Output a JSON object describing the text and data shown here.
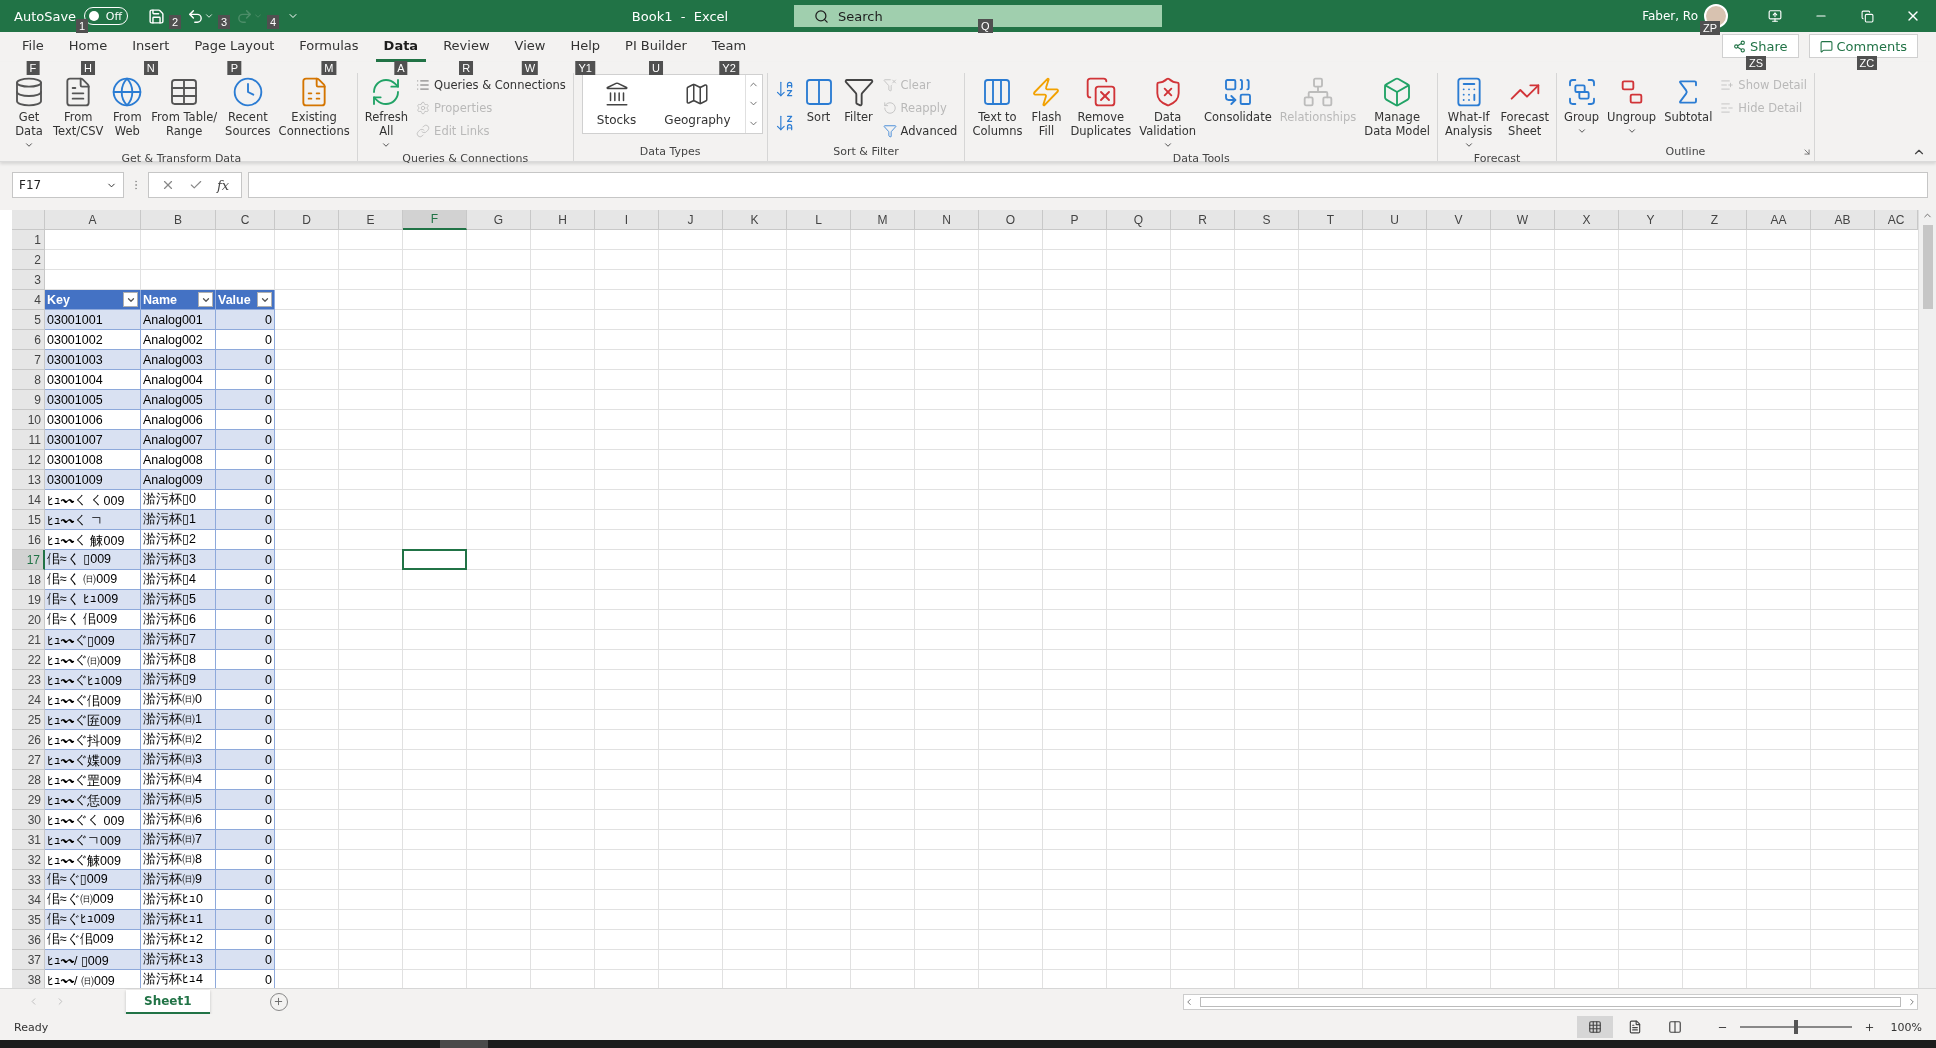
{
  "title_bar": {
    "autosave": {
      "label": "AutoSave",
      "state_text": "Off",
      "on": false,
      "key_tip": "1"
    },
    "quick_access": [
      {
        "kind": "save",
        "key_tip": "2",
        "disabled": false
      },
      {
        "kind": "undo",
        "key_tip": "3",
        "disabled": false
      },
      {
        "kind": "redo",
        "key_tip": "4",
        "disabled": true
      }
    ],
    "title": "Book1  -  Excel",
    "search": {
      "placeholder": "Search",
      "key_tip": "Q"
    },
    "user": {
      "name": "Faber, Ro",
      "key_tip": "ZP"
    }
  },
  "ribbon": {
    "tabs": [
      {
        "label": "File",
        "key_tip": "F",
        "selected": false
      },
      {
        "label": "Home",
        "key_tip": "H",
        "selected": false
      },
      {
        "label": "Insert",
        "key_tip": "N",
        "selected": false
      },
      {
        "label": "Page Layout",
        "key_tip": "P",
        "selected": false
      },
      {
        "label": "Formulas",
        "key_tip": "M",
        "selected": false
      },
      {
        "label": "Data",
        "key_tip": "A",
        "selected": true
      },
      {
        "label": "Review",
        "key_tip": "R",
        "selected": false
      },
      {
        "label": "View",
        "key_tip": "W",
        "selected": false
      },
      {
        "label": "Help",
        "key_tip": "Y1",
        "selected": false
      },
      {
        "label": "PI Builder",
        "key_tip": "U",
        "selected": false
      },
      {
        "label": "Team",
        "key_tip": "Y2",
        "selected": false
      }
    ],
    "share": {
      "label": "Share",
      "key_tip": "ZS"
    },
    "comments": {
      "label": "Comments",
      "key_tip": "ZC"
    },
    "groups": [
      {
        "label": "Get & Transform Data",
        "items": [
          {
            "kind": "large",
            "label": "Get\nData",
            "dropdown": true,
            "disabled": false
          },
          {
            "kind": "large",
            "label": "From\nText/CSV",
            "dropdown": false,
            "disabled": false
          },
          {
            "kind": "large",
            "label": "From\nWeb",
            "dropdown": false,
            "disabled": false
          },
          {
            "kind": "large",
            "label": "From Table/\nRange",
            "dropdown": false,
            "disabled": false
          },
          {
            "kind": "large",
            "label": "Recent\nSources",
            "dropdown": false,
            "disabled": false
          },
          {
            "kind": "large",
            "label": "Existing\nConnections",
            "dropdown": false,
            "disabled": false
          }
        ]
      },
      {
        "label": "Queries & Connections",
        "items": [
          {
            "kind": "large",
            "label": "Refresh\nAll",
            "dropdown": true,
            "disabled": false
          },
          {
            "kind": "small",
            "label": "Queries & Connections",
            "dropdown": false,
            "disabled": false
          },
          {
            "kind": "small",
            "label": "Properties",
            "dropdown": false,
            "disabled": true
          },
          {
            "kind": "small",
            "label": "Edit Links",
            "dropdown": false,
            "disabled": true
          }
        ]
      },
      {
        "label": "Data Types",
        "items": [
          {
            "kind": "gallery",
            "label": "Stocks",
            "dropdown": false,
            "disabled": false
          },
          {
            "kind": "gallery",
            "label": "Geography",
            "dropdown": false,
            "disabled": false
          }
        ]
      },
      {
        "label": "Sort & Filter",
        "items": [
          {
            "kind": "icon",
            "dropdown": false,
            "disabled": false
          },
          {
            "kind": "icon",
            "dropdown": false,
            "disabled": false
          },
          {
            "kind": "large",
            "label": "Sort",
            "dropdown": false,
            "disabled": false
          },
          {
            "kind": "large",
            "label": "Filter",
            "dropdown": false,
            "disabled": false
          },
          {
            "kind": "small",
            "label": "Clear",
            "dropdown": false,
            "disabled": true
          },
          {
            "kind": "small",
            "label": "Reapply",
            "dropdown": false,
            "disabled": true
          },
          {
            "kind": "small",
            "label": "Advanced",
            "dropdown": false,
            "disabled": false
          }
        ]
      },
      {
        "label": "Data Tools",
        "items": [
          {
            "kind": "large",
            "label": "Text to\nColumns",
            "dropdown": false,
            "disabled": false
          },
          {
            "kind": "large",
            "label": "Flash\nFill",
            "dropdown": false,
            "disabled": false
          },
          {
            "kind": "large",
            "label": "Remove\nDuplicates",
            "dropdown": false,
            "disabled": false
          },
          {
            "kind": "large",
            "label": "Data\nValidation",
            "dropdown": true,
            "disabled": false
          },
          {
            "kind": "large",
            "label": "Consolidate",
            "dropdown": false,
            "disabled": false
          },
          {
            "kind": "large",
            "label": "Relationships",
            "dropdown": false,
            "disabled": true
          },
          {
            "kind": "large",
            "label": "Manage\nData Model",
            "dropdown": false,
            "disabled": false
          }
        ]
      },
      {
        "label": "Forecast",
        "items": [
          {
            "kind": "large",
            "label": "What-If\nAnalysis",
            "dropdown": true,
            "disabled": false
          },
          {
            "kind": "large",
            "label": "Forecast\nSheet",
            "dropdown": false,
            "disabled": false
          }
        ]
      },
      {
        "label": "Outline",
        "items": [
          {
            "kind": "large",
            "label": "Group",
            "dropdown": true,
            "disabled": false
          },
          {
            "kind": "large",
            "label": "Ungroup",
            "dropdown": true,
            "disabled": false
          },
          {
            "kind": "large",
            "label": "Subtotal",
            "dropdown": false,
            "disabled": false
          },
          {
            "kind": "small",
            "label": "Show Detail",
            "dropdown": false,
            "disabled": true
          },
          {
            "kind": "small",
            "label": "Hide Detail",
            "dropdown": false,
            "disabled": true
          }
        ]
      }
    ]
  },
  "formula_bar": {
    "name_box": "F17",
    "fx_label": "fx"
  },
  "sheet": {
    "columns": [
      {
        "label": "A",
        "selected": false
      },
      {
        "label": "B",
        "selected": false
      },
      {
        "label": "C",
        "selected": false
      },
      {
        "label": "D",
        "selected": false
      },
      {
        "label": "E",
        "selected": false
      },
      {
        "label": "F",
        "selected": true
      },
      {
        "label": "G",
        "selected": false
      },
      {
        "label": "H",
        "selected": false
      },
      {
        "label": "I",
        "selected": false
      },
      {
        "label": "J",
        "selected": false
      },
      {
        "label": "K",
        "selected": false
      },
      {
        "label": "L",
        "selected": false
      },
      {
        "label": "M",
        "selected": false
      },
      {
        "label": "N",
        "selected": false
      },
      {
        "label": "O",
        "selected": false
      },
      {
        "label": "P",
        "selected": false
      },
      {
        "label": "Q",
        "selected": false
      },
      {
        "label": "R",
        "selected": false
      },
      {
        "label": "S",
        "selected": false
      },
      {
        "label": "T",
        "selected": false
      },
      {
        "label": "U",
        "selected": false
      },
      {
        "label": "V",
        "selected": false
      },
      {
        "label": "W",
        "selected": false
      },
      {
        "label": "X",
        "selected": false
      },
      {
        "label": "Y",
        "selected": false
      },
      {
        "label": "Z",
        "selected": false
      },
      {
        "label": "AA",
        "selected": false
      },
      {
        "label": "AB",
        "selected": false
      },
      {
        "label": "AC",
        "selected": false
      }
    ],
    "rows": [
      {
        "number": "1",
        "selected": false
      },
      {
        "number": "2",
        "selected": false
      },
      {
        "number": "3",
        "selected": false
      },
      {
        "number": "4",
        "selected": false
      },
      {
        "number": "5",
        "selected": false
      },
      {
        "number": "6",
        "selected": false
      },
      {
        "number": "7",
        "selected": false
      },
      {
        "number": "8",
        "selected": false
      },
      {
        "number": "9",
        "selected": false
      },
      {
        "number": "10",
        "selected": false
      },
      {
        "number": "11",
        "selected": false
      },
      {
        "number": "12",
        "selected": false
      },
      {
        "number": "13",
        "selected": false
      },
      {
        "number": "14",
        "selected": false
      },
      {
        "number": "15",
        "selected": false
      },
      {
        "number": "16",
        "selected": false
      },
      {
        "number": "17",
        "selected": true
      },
      {
        "number": "18",
        "selected": false
      },
      {
        "number": "19",
        "selected": false
      },
      {
        "number": "20",
        "selected": false
      },
      {
        "number": "21",
        "selected": false
      },
      {
        "number": "22",
        "selected": false
      },
      {
        "number": "23",
        "selected": false
      },
      {
        "number": "24",
        "selected": false
      },
      {
        "number": "25",
        "selected": false
      },
      {
        "number": "26",
        "selected": false
      },
      {
        "number": "27",
        "selected": false
      },
      {
        "number": "28",
        "selected": false
      },
      {
        "number": "29",
        "selected": false
      },
      {
        "number": "30",
        "selected": false
      },
      {
        "number": "31",
        "selected": false
      },
      {
        "number": "32",
        "selected": false
      },
      {
        "number": "33",
        "selected": false
      },
      {
        "number": "34",
        "selected": false
      },
      {
        "number": "35",
        "selected": false
      },
      {
        "number": "36",
        "selected": false
      },
      {
        "number": "37",
        "selected": false
      },
      {
        "number": "38",
        "selected": false
      }
    ],
    "table": {
      "columns": [
        "Key",
        "Name",
        "Value"
      ],
      "rows": [
        [
          "03001001",
          "Analog001",
          "0"
        ],
        [
          "03001002",
          "Analog002",
          "0"
        ],
        [
          "03001003",
          "Analog003",
          "0"
        ],
        [
          "03001004",
          "Analog004",
          "0"
        ],
        [
          "03001005",
          "Analog005",
          "0"
        ],
        [
          "03001006",
          "Analog006",
          "0"
        ],
        [
          "03001007",
          "Analog007",
          "0"
        ],
        [
          "03001008",
          "Analog008",
          "0"
        ],
        [
          "03001009",
          "Analog009",
          "0"
        ],
        [
          "ﾋｭ〰く く009",
          "湁污杯▯0",
          "0"
        ],
        [
          "ﾋｭ〰く ㄱ",
          "湁污杯▯1",
          "0"
        ],
        [
          "ﾋｭ〰く 觫009",
          "湁污杯▯2",
          "0"
        ],
        [
          "佀≈く ▯009",
          "湁污杯▯3",
          "0"
        ],
        [
          "佀≈く ㈰009",
          "湁污杯▯4",
          "0"
        ],
        [
          "佀≈く ﾋｭ009",
          "湁污杯▯5",
          "0"
        ],
        [
          "佀≈く 佀009",
          "湁污杯▯6",
          "0"
        ],
        [
          "ﾋｭ〰ぐ▯009",
          "湁污杯▯7",
          "0"
        ],
        [
          "ﾋｭ〰ぐ㈰009",
          "湁污杯▯8",
          "0"
        ],
        [
          "ﾋｭ〰ぐﾋｭ009",
          "湁污杯▯9",
          "0"
        ],
        [
          "ﾋｭ〰ぐ佀009",
          "湁污杯㈰0",
          "0"
        ],
        [
          "ﾋｭ〰ぐ匥009",
          "湁污杯㈰1",
          "0"
        ],
        [
          "ﾋｭ〰ぐ抖009",
          "湁污杯㈰2",
          "0"
        ],
        [
          "ﾋｭ〰ぐ媟009",
          "湁污杯㈰3",
          "0"
        ],
        [
          "ﾋｭ〰ぐ罡009",
          "湁污杯㈰4",
          "0"
        ],
        [
          "ﾋｭ〰ぐ恁009",
          "湁污杯㈰5",
          "0"
        ],
        [
          "ﾋｭ〰ぐく 009",
          "湁污杯㈰6",
          "0"
        ],
        [
          "ﾋｭ〰ぐㄱ009",
          "湁污杯㈰7",
          "0"
        ],
        [
          "ﾋｭ〰ぐ觫009",
          "湁污杯㈰8",
          "0"
        ],
        [
          "佀≈ぐ▯009",
          "湁污杯㈰9",
          "0"
        ],
        [
          "佀≈ぐ㈰009",
          "湁污杯ﾋｭ0",
          "0"
        ],
        [
          "佀≈ぐﾋｭ009",
          "湁污杯ﾋｭ1",
          "0"
        ],
        [
          "佀≈ぐ佀009",
          "湁污杯ﾋｭ2",
          "0"
        ],
        [
          "ﾋｭ〰/ ▯009",
          "湁污杯ﾋｭ3",
          "0"
        ],
        [
          "ﾋｭ〰/ ㈰009",
          "湁污杯ﾋｭ4",
          "0"
        ]
      ]
    },
    "sheet_tabs": [
      {
        "label": "Sheet1",
        "selected": true
      }
    ]
  },
  "status_bar": {
    "text": "Ready",
    "views": [
      {
        "selected": true
      },
      {
        "selected": false
      },
      {
        "selected": false
      }
    ],
    "zoom": {
      "level": 0.5,
      "text": "100%"
    }
  }
}
